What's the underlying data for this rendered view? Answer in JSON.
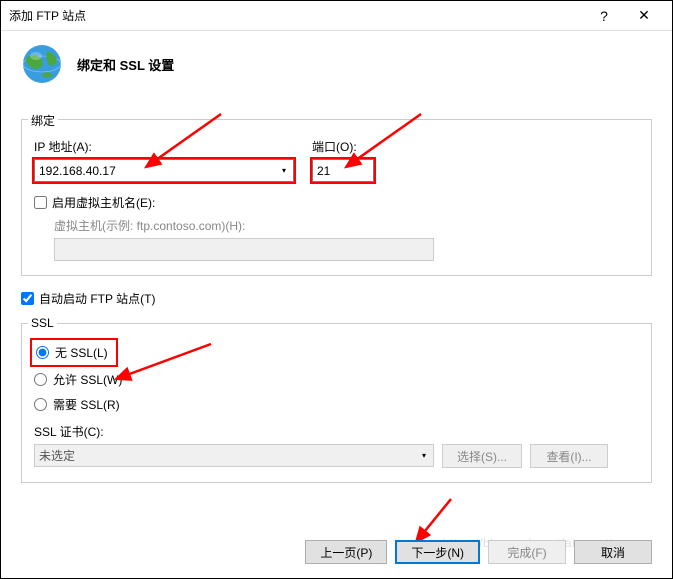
{
  "titlebar": {
    "title": "添加 FTP 站点"
  },
  "header": {
    "title": "绑定和 SSL 设置"
  },
  "binding": {
    "legend": "绑定",
    "ip_label": "IP 地址(A):",
    "ip_value": "192.168.40.17",
    "port_label": "端口(O):",
    "port_value": "21",
    "vhost_checkbox": "启用虚拟主机名(E):",
    "vhost_label": "虚拟主机(示例: ftp.contoso.com)(H):",
    "vhost_value": ""
  },
  "auto_start_label": "自动启动 FTP 站点(T)",
  "ssl": {
    "legend": "SSL",
    "none": "无 SSL(L)",
    "allow": "允许 SSL(W)",
    "require": "需要 SSL(R)",
    "cert_label": "SSL 证书(C):",
    "cert_value": "未选定",
    "select_btn": "选择(S)...",
    "view_btn": "查看(I)..."
  },
  "footer": {
    "prev": "上一页(P)",
    "next": "下一步(N)",
    "finish": "完成(F)",
    "cancel": "取消"
  },
  "watermark": "https://blog.csdn.net/aiwangtingyun"
}
